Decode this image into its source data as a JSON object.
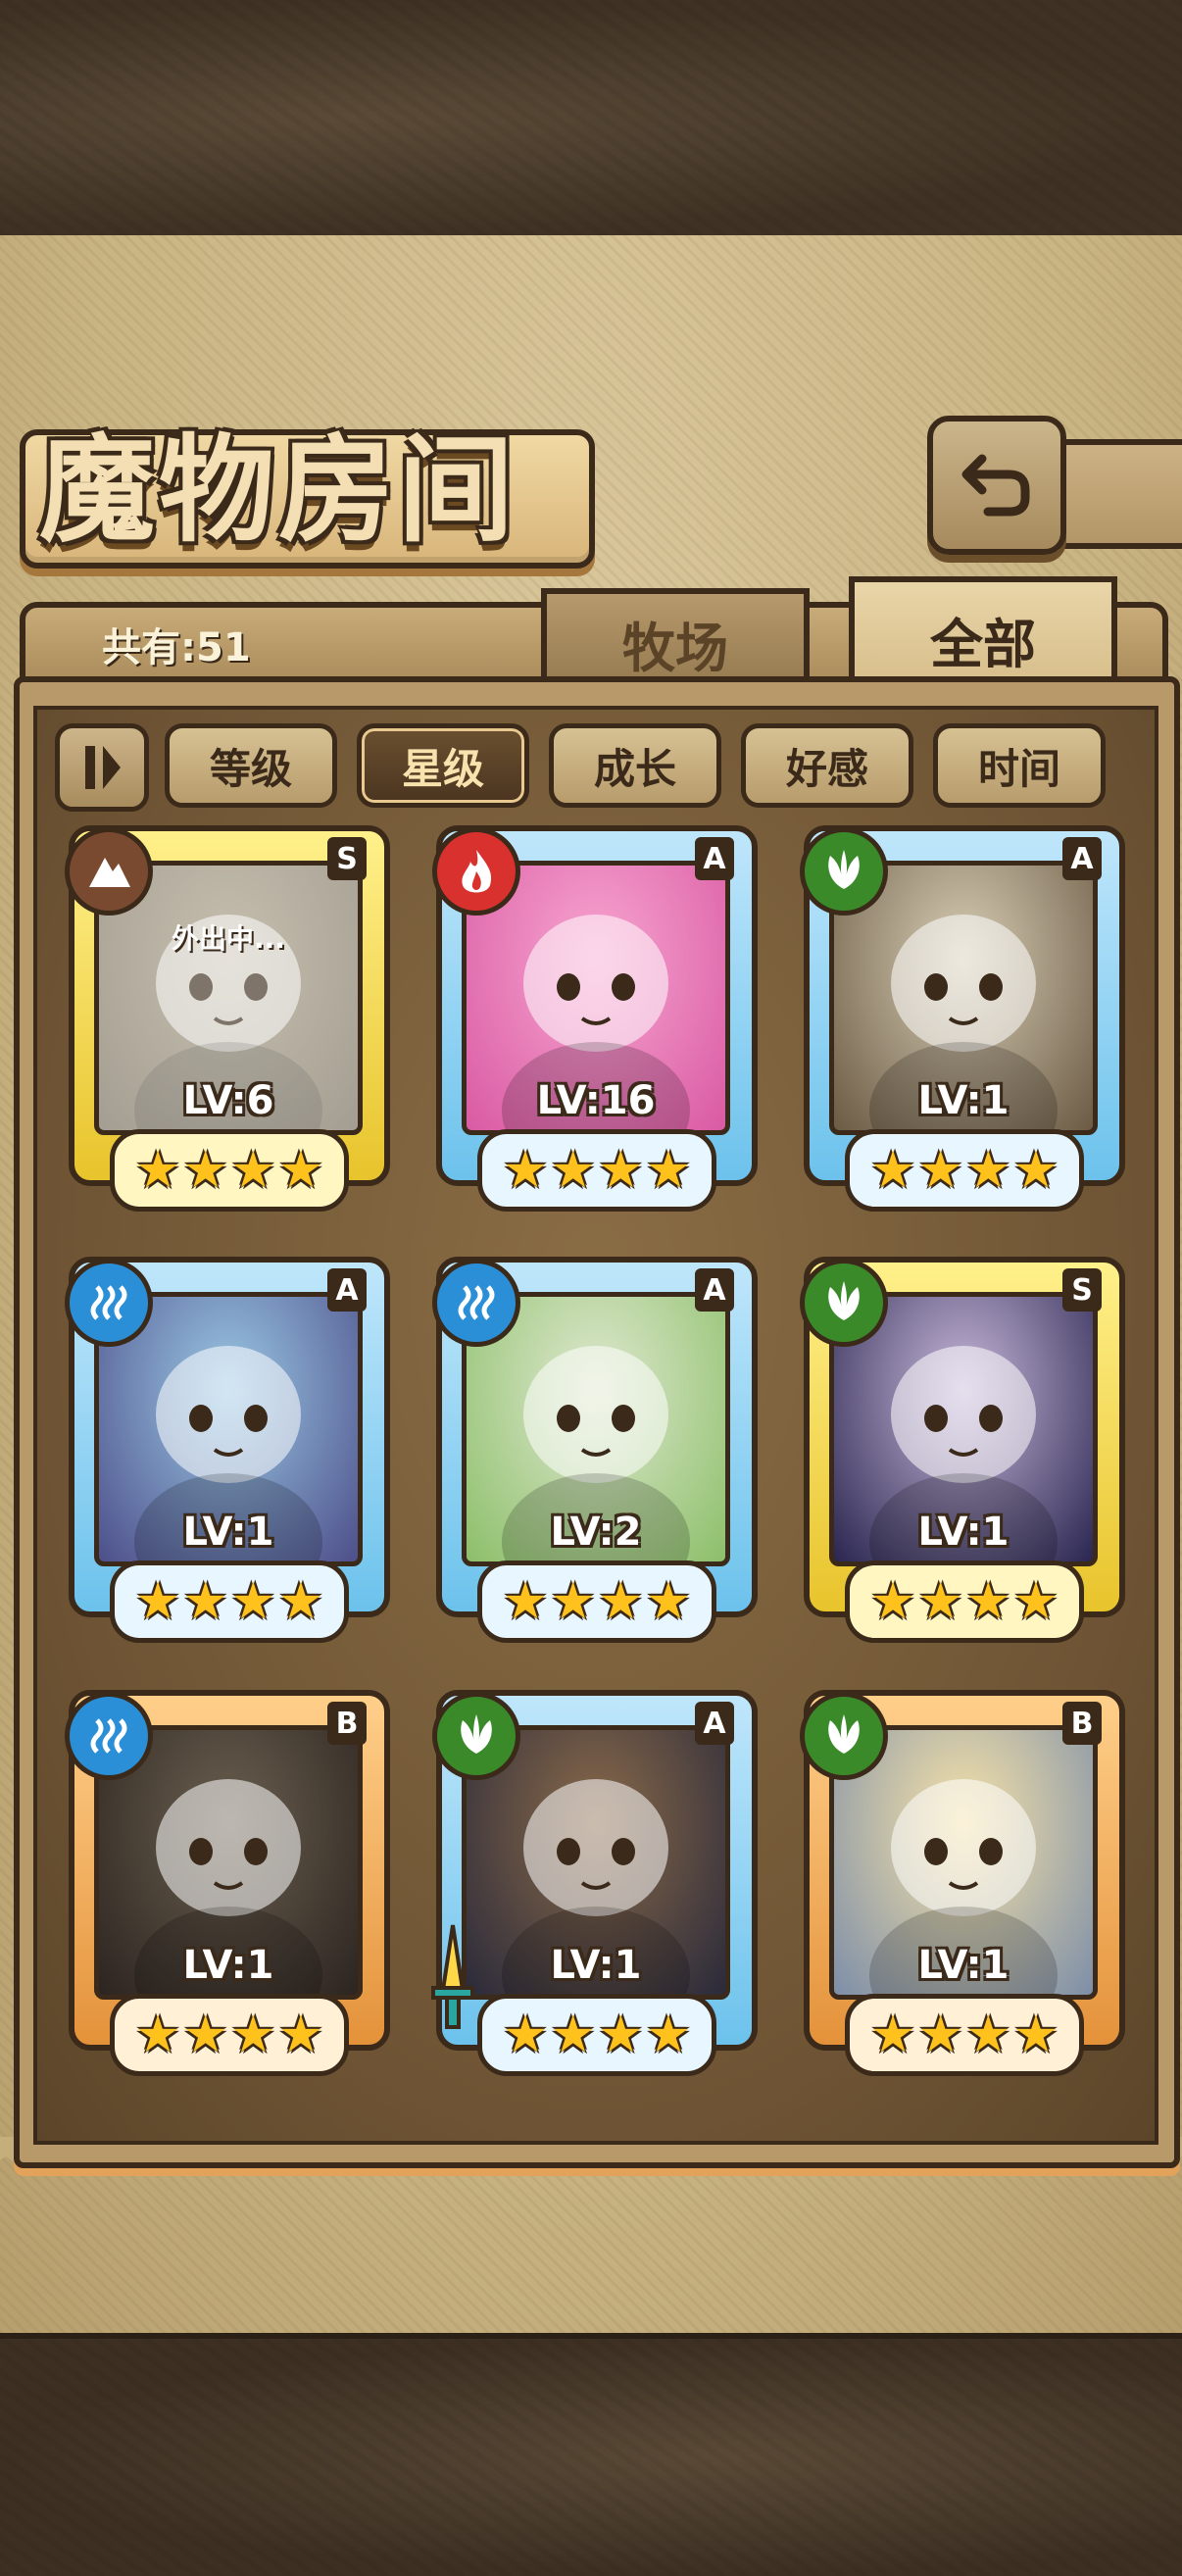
{
  "header": {
    "title": "魔物房间"
  },
  "summary": {
    "count_label": "共有:51"
  },
  "tabs": [
    {
      "label": "牧场",
      "active": false
    },
    {
      "label": "全部",
      "active": true
    }
  ],
  "sort": {
    "buttons": [
      {
        "label": "等级",
        "active": false
      },
      {
        "label": "星级",
        "active": true
      },
      {
        "label": "成长",
        "active": false
      },
      {
        "label": "好感",
        "active": false
      },
      {
        "label": "时间",
        "active": false
      }
    ]
  },
  "monsters": [
    {
      "rank": "S",
      "element": "earth-icon",
      "level": "LV:6",
      "stars": 4,
      "frame": "gold",
      "status": "外出中..."
    },
    {
      "rank": "A",
      "element": "fire-icon",
      "level": "LV:16",
      "stars": 4,
      "frame": "blue",
      "status": ""
    },
    {
      "rank": "A",
      "element": "leaf-icon",
      "level": "LV:1",
      "stars": 4,
      "frame": "blue",
      "status": ""
    },
    {
      "rank": "A",
      "element": "water-icon",
      "level": "LV:1",
      "stars": 4,
      "frame": "blue",
      "status": ""
    },
    {
      "rank": "A",
      "element": "water-icon",
      "level": "LV:2",
      "stars": 4,
      "frame": "blue",
      "status": ""
    },
    {
      "rank": "S",
      "element": "leaf-icon",
      "level": "LV:1",
      "stars": 4,
      "frame": "gold",
      "status": ""
    },
    {
      "rank": "B",
      "element": "water-icon",
      "level": "LV:1",
      "stars": 4,
      "frame": "orange",
      "status": ""
    },
    {
      "rank": "A",
      "element": "leaf-icon",
      "level": "LV:1",
      "stars": 4,
      "frame": "blue",
      "status": ""
    },
    {
      "rank": "B",
      "element": "leaf-icon",
      "level": "LV:1",
      "stars": 4,
      "frame": "orange",
      "status": ""
    }
  ],
  "colors": {
    "fire": "#d9312e",
    "water": "#2a8fd6",
    "leaf": "#3a8a2a",
    "earth": "#7a4a30",
    "star": "#ffc21c"
  }
}
